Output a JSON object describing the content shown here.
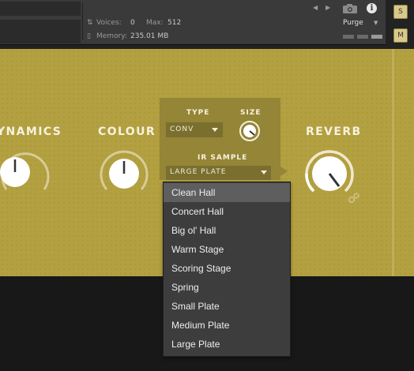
{
  "header": {
    "voices_label": "Voices:",
    "voices_value": "0",
    "max_label": "Max:",
    "max_value": "512",
    "memory_label": "Memory:",
    "memory_value": "235.01 MB",
    "purge_label": "Purge",
    "info_glyph": "i",
    "solo_label": "S",
    "mute_label": "M"
  },
  "sections": {
    "dynamics_title": "YNAMICS",
    "colour_title": "COLOUR",
    "reverb_title": "REVERB"
  },
  "reverb_popup": {
    "type_label": "TYPE",
    "type_value": "CONV",
    "size_label": "SIZE",
    "ir_label": "IR SAMPLE",
    "ir_value": "LARGE PLATE"
  },
  "ir_menu": {
    "items": [
      "Clean Hall",
      "Concert Hall",
      "Big ol' Hall",
      "Warm Stage",
      "Scoring Stage",
      "Spring",
      "Small Plate",
      "Medium Plate",
      "Large Plate"
    ],
    "selected": "Clean Hall"
  },
  "colors": {
    "panel_gold": "#b3a040",
    "menu_bg": "#3d3d3d",
    "menu_highlight": "#5e5e5e"
  }
}
